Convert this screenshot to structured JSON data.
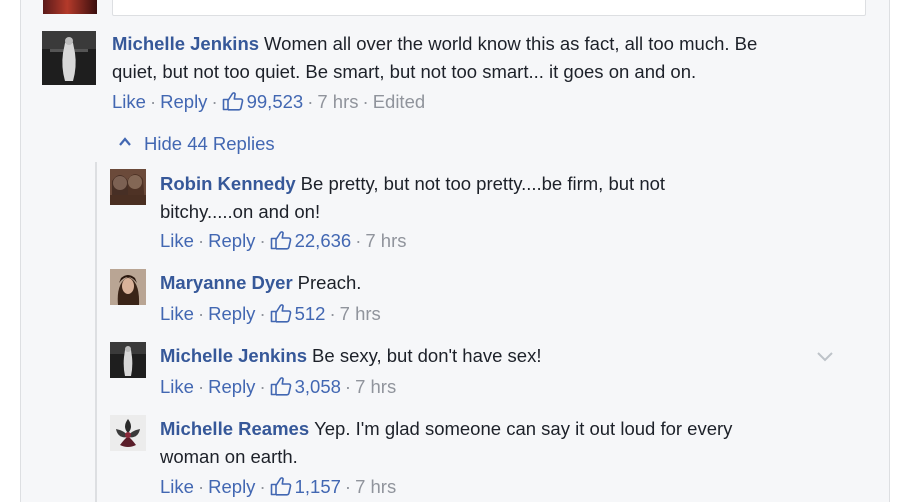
{
  "comment": {
    "author": "Michelle Jenkins",
    "text_line1": "Women all over the world know this as fact, all too much. Be",
    "text_line2": "quiet, but not too quiet. Be smart, but not too smart... it goes on and on.",
    "like": "Like",
    "reply": "Reply",
    "likes": "99,523",
    "time": "7 hrs",
    "edited": "Edited"
  },
  "replies_toggle": {
    "label": "Hide 44 Replies",
    "icon": "chevron-up-icon"
  },
  "replies": [
    {
      "author": "Robin Kennedy",
      "text_line1": "Be pretty, but not too pretty....be firm, but not",
      "text_line2": "bitchy.....on and on!",
      "like": "Like",
      "reply": "Reply",
      "likes": "22,636",
      "time": "7 hrs"
    },
    {
      "author": "Maryanne Dyer",
      "text_line1": "Preach.",
      "like": "Like",
      "reply": "Reply",
      "likes": "512",
      "time": "7 hrs"
    },
    {
      "author": "Michelle Jenkins",
      "text_line1": "Be sexy, but don't have sex!",
      "like": "Like",
      "reply": "Reply",
      "likes": "3,058",
      "time": "7 hrs"
    },
    {
      "author": "Michelle Reames",
      "text_line1": "Yep. I'm glad someone can say it out loud for every",
      "text_line2": "woman on earth.",
      "like": "Like",
      "reply": "Reply",
      "likes": "1,157",
      "time": "7 hrs"
    }
  ],
  "colors": {
    "link": "#4267b2",
    "author": "#365899",
    "text": "#1d2129",
    "meta": "#90949c",
    "background": "#f6f7f9"
  }
}
